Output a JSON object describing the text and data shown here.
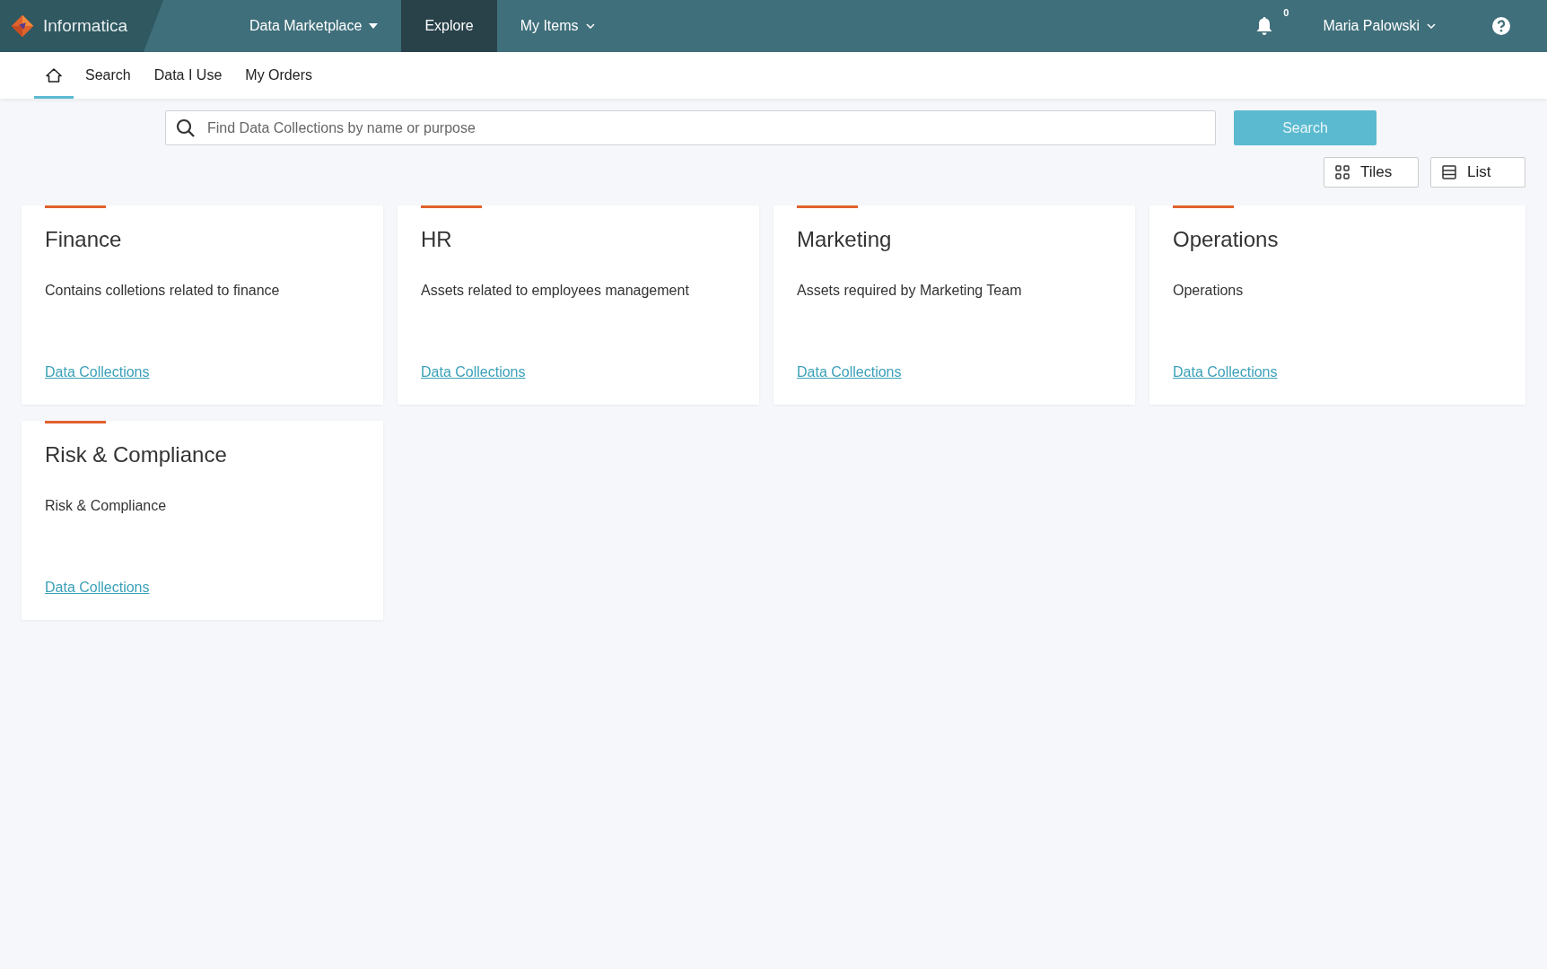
{
  "top_bar": {
    "brand": "Informatica",
    "nav": [
      {
        "label": "Data Marketplace",
        "selected": false,
        "kind": "dropdown"
      },
      {
        "label": "Explore",
        "selected": true,
        "kind": "plain"
      },
      {
        "label": "My Items",
        "selected": false,
        "kind": "chevron"
      }
    ],
    "notification_count": "0",
    "user": "Maria Palowski"
  },
  "sub_nav": [
    {
      "kind": "home",
      "selected": true
    },
    {
      "kind": "text",
      "label": "Search",
      "selected": false
    },
    {
      "kind": "text",
      "label": "Data I Use",
      "selected": false
    },
    {
      "kind": "text",
      "label": "My Orders",
      "selected": false
    }
  ],
  "search": {
    "placeholder": "Find Data Collections by name or purpose",
    "button": "Search"
  },
  "view_toggle": [
    {
      "kind": "tiles",
      "label": "Tiles"
    },
    {
      "kind": "list",
      "label": "List"
    }
  ],
  "cards": [
    {
      "title": "Finance",
      "description": "Contains colletions related to finance",
      "link": "Data Collections"
    },
    {
      "title": "HR",
      "description": "Assets related to employees management",
      "link": "Data Collections"
    },
    {
      "title": "Marketing",
      "description": "Assets required by Marketing Team",
      "link": "Data Collections"
    },
    {
      "title": "Operations",
      "description": "Operations",
      "link": "Data Collections"
    },
    {
      "title": "Risk & Compliance",
      "description": "Risk & Compliance",
      "link": "Data Collections"
    }
  ]
}
